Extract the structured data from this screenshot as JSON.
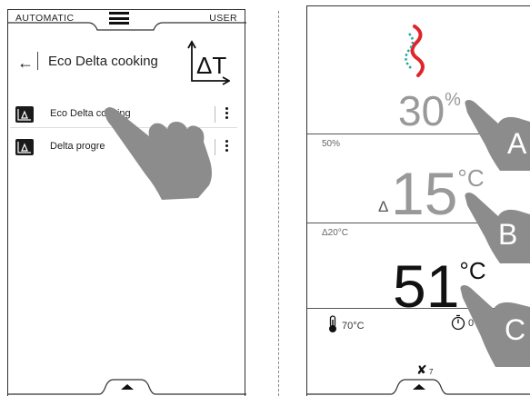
{
  "left_screen": {
    "topbar": {
      "mode_left": "AUTOMATIC",
      "mode_right": "USER",
      "menu_icon": "hamburger-menu-icon"
    },
    "header": {
      "back_icon": "back-arrow-icon",
      "title": "Eco Delta cooking",
      "title_icon": "delta-t-icon",
      "title_icon_text": "ΔT"
    },
    "list": [
      {
        "label": "Eco Delta cooking",
        "icon": "delta-t-icon"
      },
      {
        "label": "Delta progre",
        "icon": "delta-t-icon"
      }
    ],
    "bottom_tab_icon": "chevron-up-icon"
  },
  "right_screen": {
    "humidity": {
      "value": "30",
      "unit": "%",
      "setpoint": "50%"
    },
    "delta_temp": {
      "prefix": "Δ",
      "value": "15",
      "unit": "°C",
      "setpoint": "Δ20°C"
    },
    "core_temp": {
      "value": "51",
      "unit": "°C"
    },
    "meta": {
      "probe_setpoint": "70°C",
      "timer_text": "0"
    },
    "fan": {
      "icon": "fan-icon",
      "level": "7"
    },
    "bottom_tab_icon": "chevron-up-icon"
  },
  "callouts": [
    "A",
    "B",
    "C"
  ],
  "colors": {
    "logo_red": "#e0242b",
    "logo_teal": "#2ba39a",
    "hand": "#8c8c8c",
    "callout": "#8c8c8c"
  }
}
